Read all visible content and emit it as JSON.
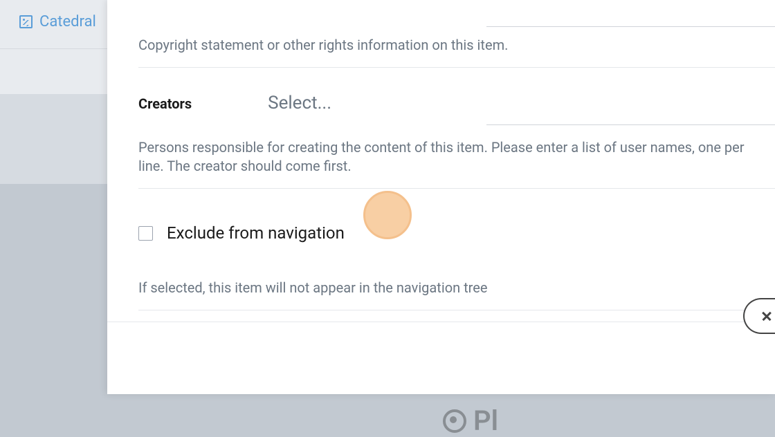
{
  "sidebar": {
    "item_label": "Catedral"
  },
  "form": {
    "copyright_help": "Copyright statement or other rights information on this item.",
    "creators_label": "Creators",
    "creators_placeholder": "Select...",
    "creators_help": "Persons responsible for creating the content of this item. Please enter a list of user names, one per line. The creator should come first.",
    "exclude_label": "Exclude from navigation",
    "exclude_help": "If selected, this item will not appear in the navigation tree"
  },
  "footer": {
    "logo_text": "Pl"
  }
}
